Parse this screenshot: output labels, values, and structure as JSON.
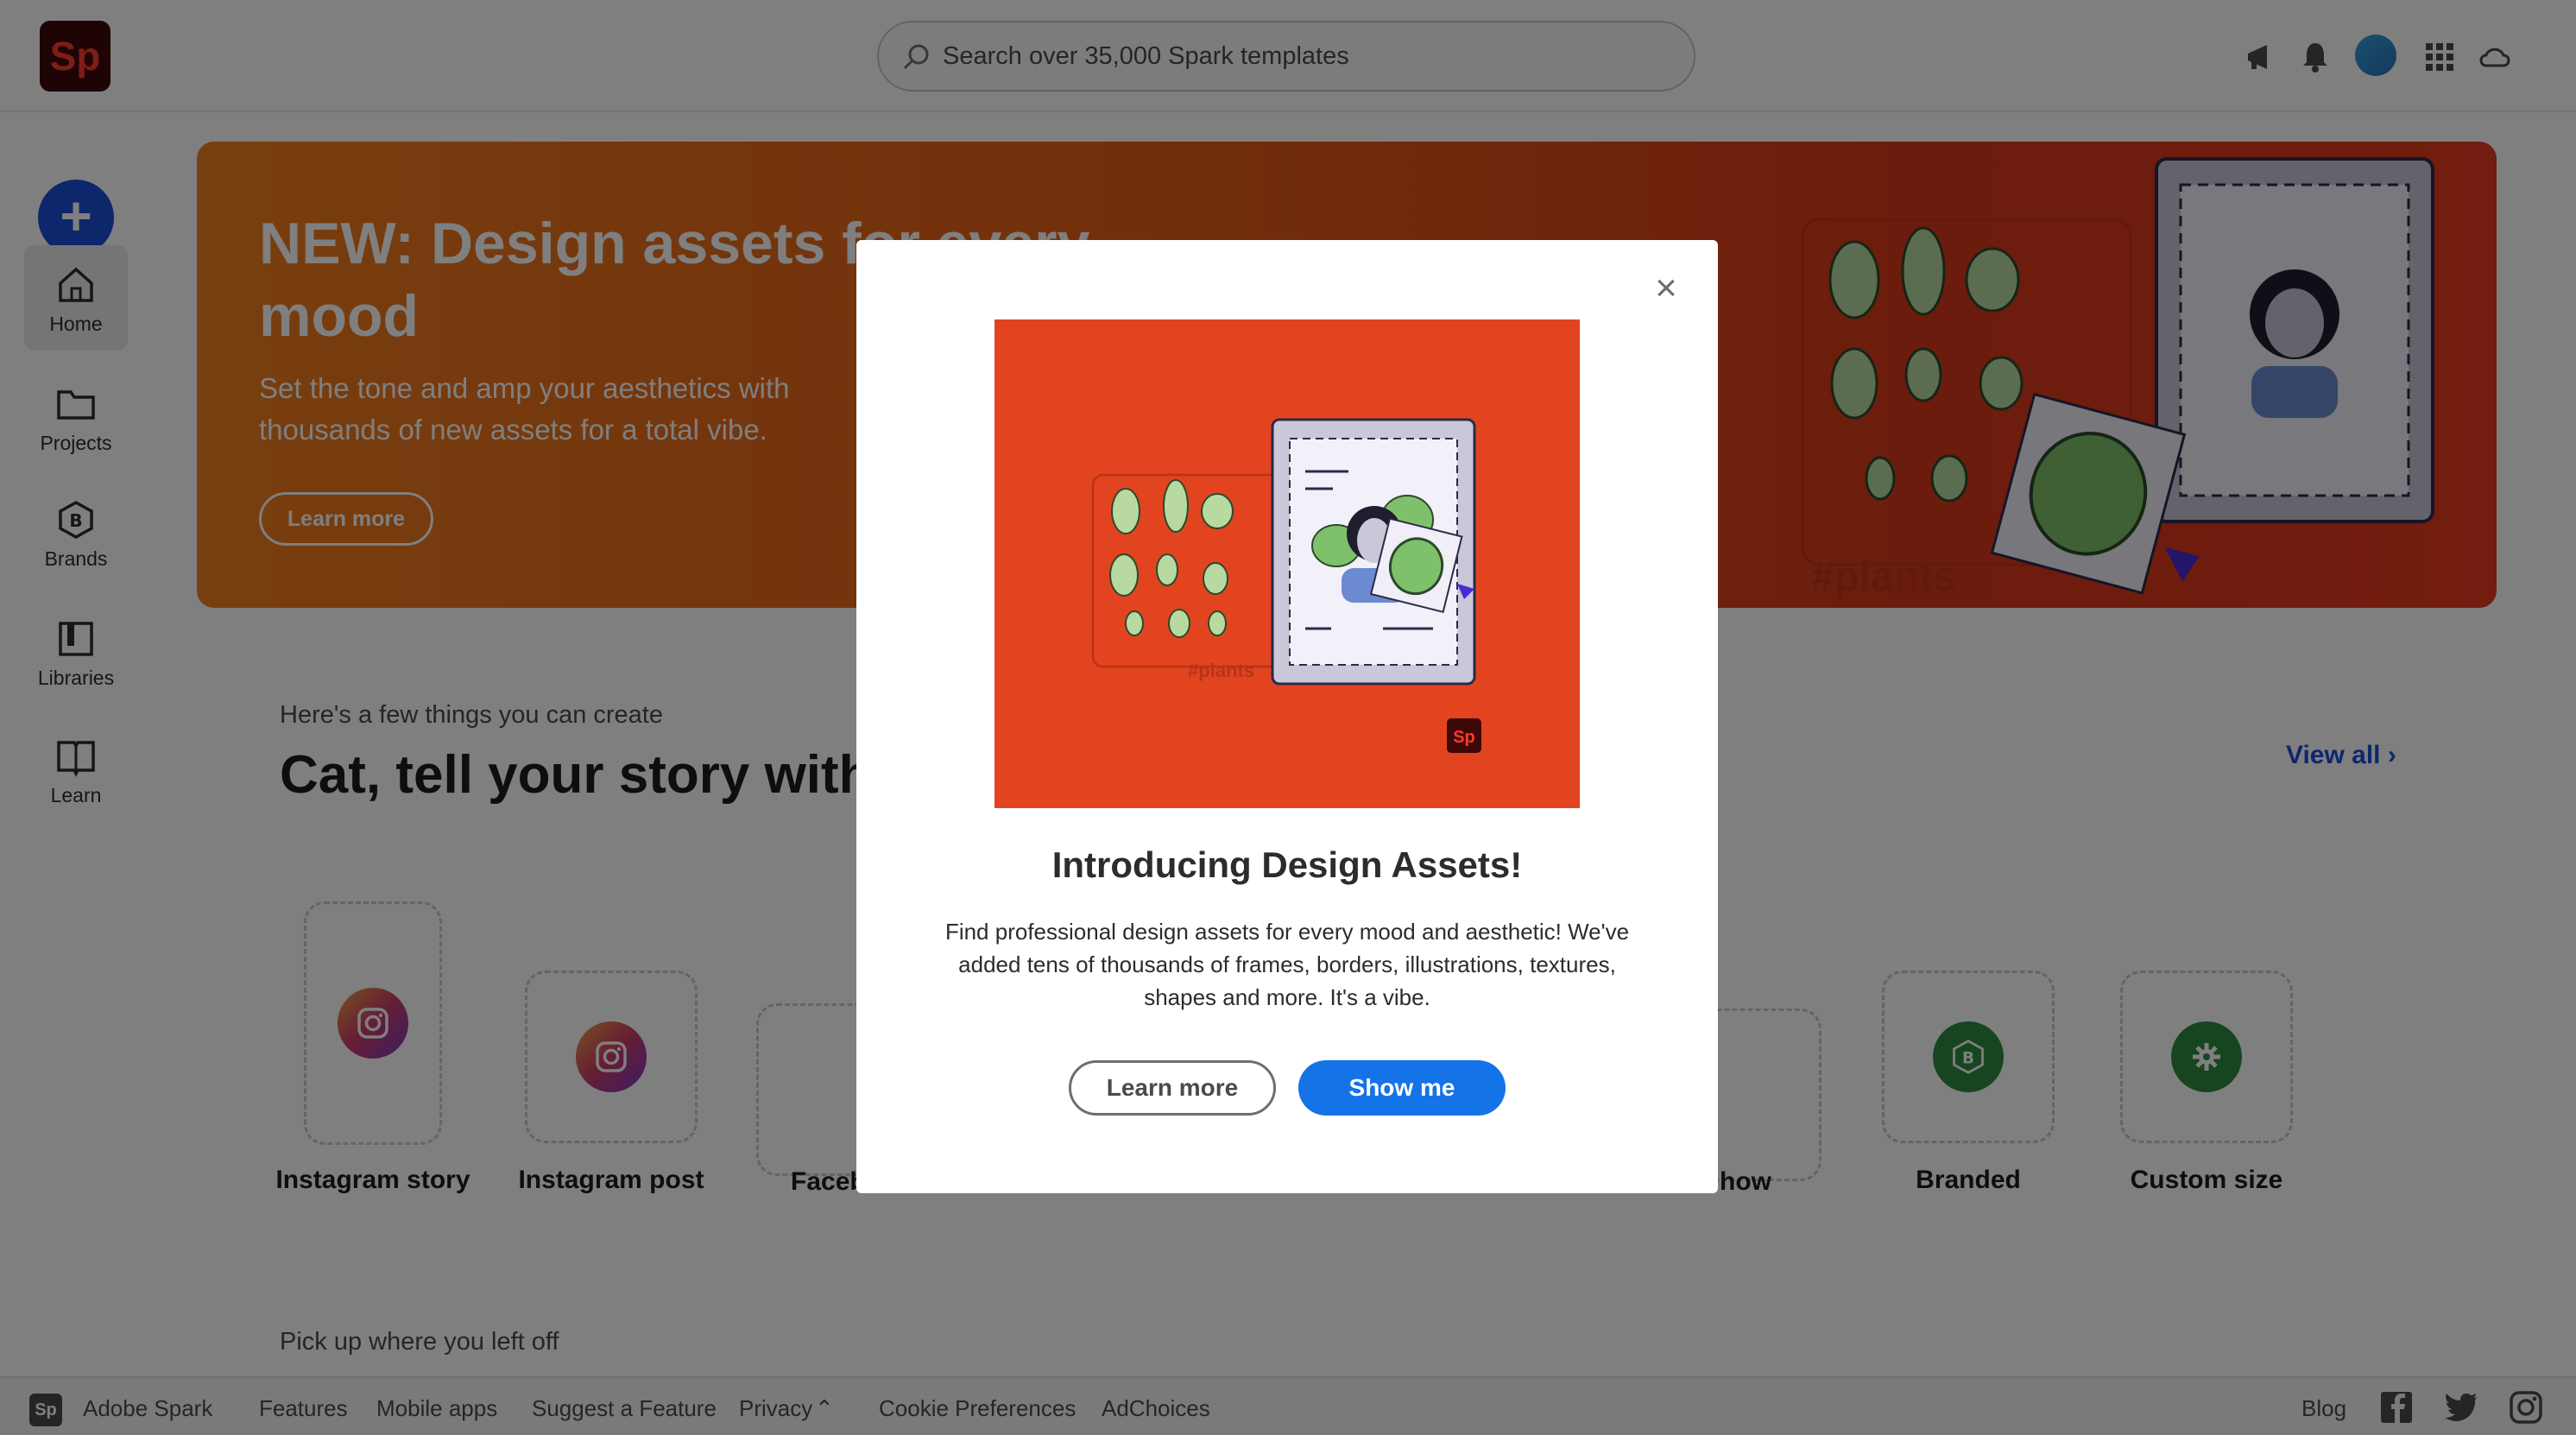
{
  "app": {
    "logo_text": "Sp"
  },
  "search": {
    "placeholder": "Search over 35,000 Spark templates"
  },
  "topbar": {
    "icons": [
      "announcement-icon",
      "bell-icon",
      "avatar",
      "apps-grid-icon",
      "creative-cloud-icon"
    ]
  },
  "rail": {
    "create_label": "+",
    "items": [
      {
        "label": "Home",
        "icon": "home-icon",
        "active": true
      },
      {
        "label": "Projects",
        "icon": "folder-icon",
        "active": false
      },
      {
        "label": "Brands",
        "icon": "brand-icon",
        "active": false
      },
      {
        "label": "Libraries",
        "icon": "library-icon",
        "active": false
      },
      {
        "label": "Learn",
        "icon": "book-icon",
        "active": false
      }
    ]
  },
  "hero": {
    "title": "NEW: Design assets for every mood",
    "subtitle": "Set the tone and amp your aesthetics with thousands of new assets for a total vibe.",
    "button": "Learn more",
    "art_tag": "#plants"
  },
  "section": {
    "eyebrow": "Here's a few things you can create",
    "title": "Cat, tell your story with",
    "view_all": "View all",
    "cards": [
      {
        "label": "Instagram story",
        "icon": "instagram-icon",
        "color": "#c93a6a"
      },
      {
        "label": "Instagram post",
        "icon": "instagram-icon",
        "color": "#c93a6a"
      },
      {
        "label": "Faceb",
        "icon": "facebook-icon",
        "color": "#1a4fd8"
      },
      {
        "label": "how",
        "icon": "slideshow-icon",
        "color": "#e0442a"
      },
      {
        "label": "Branded",
        "icon": "brand-icon",
        "color": "#2e8b3f"
      },
      {
        "label": "Custom size",
        "icon": "gear-icon",
        "color": "#2e8b3f"
      }
    ],
    "pickup": "Pick up where you left off"
  },
  "footer": {
    "logo_text": "Sp",
    "brand": "Adobe Spark",
    "links": [
      "Features",
      "Mobile apps",
      "Suggest a Feature",
      "Privacy",
      "Cookie Preferences",
      "AdChoices"
    ],
    "blog": "Blog"
  },
  "modal": {
    "close": "×",
    "image_tag": "#plants",
    "image_logo": "Sp",
    "title": "Introducing Design Assets!",
    "body": "Find professional design assets for every mood and aesthetic! We've added tens of thousands of frames, borders, illustrations, textures, shapes and more. It's a vibe.",
    "secondary_button": "Learn more",
    "primary_button": "Show me"
  },
  "colors": {
    "accent": "#1473e6",
    "create": "#1a4fd8",
    "hero_orange": "#ef7e1e",
    "hero_red": "#d83819"
  }
}
